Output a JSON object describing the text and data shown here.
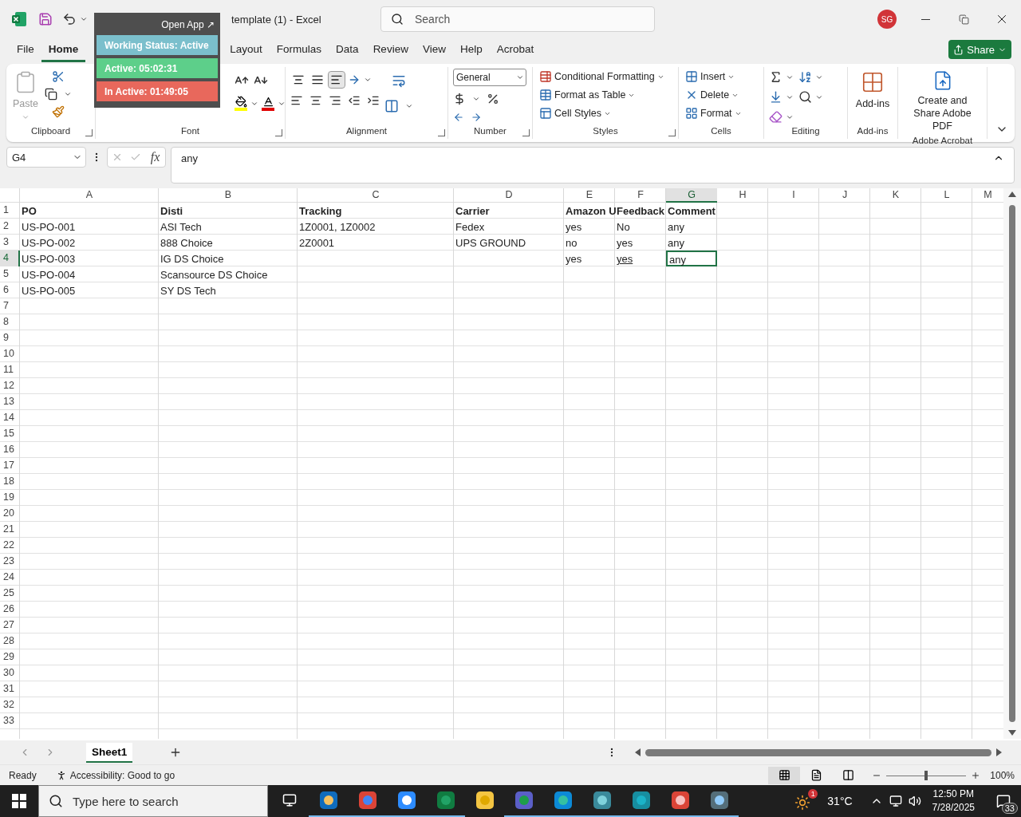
{
  "title_bar": {
    "title": "template (1)  -  Excel",
    "search": {
      "placeholder": "Search"
    },
    "avatar": "SG"
  },
  "tracker_widget": {
    "open_app": "Open App ↗",
    "statuses": [
      {
        "text": "Working Status: Active",
        "color": "#7bbfcc"
      },
      {
        "text": "Active: 05:02:31",
        "color": "#5dcf8a"
      },
      {
        "text": "In Active: 01:49:05",
        "color": "#e8685c"
      }
    ]
  },
  "tabs": [
    {
      "label": "File",
      "selected": false
    },
    {
      "label": "Home",
      "selected": true
    },
    {
      "label": "Layout",
      "selected": false
    },
    {
      "label": "Formulas",
      "selected": false
    },
    {
      "label": "Data",
      "selected": false
    },
    {
      "label": "Review",
      "selected": false
    },
    {
      "label": "View",
      "selected": false
    },
    {
      "label": "Help",
      "selected": false
    },
    {
      "label": "Acrobat",
      "selected": false
    }
  ],
  "share": "Share",
  "ribbon": {
    "clipboard": {
      "paste": "Paste",
      "label": "Clipboard"
    },
    "font": {
      "label": "Font"
    },
    "alignment": {
      "label": "Alignment",
      "vertical": [
        {
          "selected": false
        },
        {
          "selected": false
        },
        {
          "selected": true
        }
      ]
    },
    "number": {
      "format": "General",
      "label": "Number"
    },
    "styles": {
      "items": [
        "Conditional Formatting",
        "Format as Table",
        "Cell Styles"
      ],
      "label": "Styles"
    },
    "cells": {
      "items": [
        "Insert",
        "Delete",
        "Format"
      ],
      "label": "Cells"
    },
    "editing": {
      "label": "Editing"
    },
    "addins": {
      "button": "Add-ins",
      "label": "Add-ins"
    },
    "acrobat": {
      "button": "Create and Share Adobe PDF",
      "label": "Adobe Acrobat"
    }
  },
  "formula_bar": {
    "name_box": "G4",
    "fx": "fx",
    "value": "any"
  },
  "sheet": {
    "columns": [
      {
        "label": "A",
        "selected": false
      },
      {
        "label": "B",
        "selected": false
      },
      {
        "label": "C",
        "selected": false
      },
      {
        "label": "D",
        "selected": false
      },
      {
        "label": "E",
        "selected": false
      },
      {
        "label": "F",
        "selected": false
      },
      {
        "label": "G",
        "selected": true
      },
      {
        "label": "H",
        "selected": false
      },
      {
        "label": "I",
        "selected": false
      },
      {
        "label": "J",
        "selected": false
      },
      {
        "label": "K",
        "selected": false
      },
      {
        "label": "L",
        "selected": false
      },
      {
        "label": "M",
        "selected": false
      }
    ],
    "rows": [
      {
        "number": "1",
        "selected": false,
        "cells": [
          {
            "text": "PO",
            "bold": true,
            "underlined": false,
            "selected": false
          },
          {
            "text": "Disti",
            "bold": true,
            "underlined": false,
            "selected": false
          },
          {
            "text": "Tracking",
            "bold": true,
            "underlined": false,
            "selected": false
          },
          {
            "text": "Carrier",
            "bold": true,
            "underlined": false,
            "selected": false
          },
          {
            "text": "Amazon U",
            "bold": true,
            "underlined": false,
            "selected": false
          },
          {
            "text": "Feedback",
            "bold": true,
            "underlined": false,
            "selected": false
          },
          {
            "text": "Comment",
            "bold": true,
            "underlined": false,
            "selected": false
          }
        ]
      },
      {
        "number": "2",
        "selected": false,
        "cells": [
          {
            "text": "US-PO-001",
            "bold": false,
            "underlined": false,
            "selected": false
          },
          {
            "text": "ASI Tech",
            "bold": false,
            "underlined": false,
            "selected": false
          },
          {
            "text": "1Z0001, 1Z0002",
            "bold": false,
            "underlined": false,
            "selected": false
          },
          {
            "text": "Fedex",
            "bold": false,
            "underlined": false,
            "selected": false
          },
          {
            "text": "yes",
            "bold": false,
            "underlined": false,
            "selected": false
          },
          {
            "text": "No",
            "bold": false,
            "underlined": false,
            "selected": false
          },
          {
            "text": "any",
            "bold": false,
            "underlined": false,
            "selected": false
          }
        ]
      },
      {
        "number": "3",
        "selected": false,
        "cells": [
          {
            "text": "US-PO-002",
            "bold": false,
            "underlined": false,
            "selected": false
          },
          {
            "text": "888 Choice",
            "bold": false,
            "underlined": false,
            "selected": false
          },
          {
            "text": "2Z0001",
            "bold": false,
            "underlined": false,
            "selected": false
          },
          {
            "text": "UPS GROUND",
            "bold": false,
            "underlined": false,
            "selected": false
          },
          {
            "text": "no",
            "bold": false,
            "underlined": false,
            "selected": false
          },
          {
            "text": "yes",
            "bold": false,
            "underlined": false,
            "selected": false
          },
          {
            "text": "any",
            "bold": false,
            "underlined": false,
            "selected": false
          }
        ]
      },
      {
        "number": "4",
        "selected": true,
        "cells": [
          {
            "text": "US-PO-003",
            "bold": false,
            "underlined": false,
            "selected": false
          },
          {
            "text": "IG DS Choice",
            "bold": false,
            "underlined": false,
            "selected": false
          },
          null,
          null,
          {
            "text": "yes",
            "bold": false,
            "underlined": false,
            "selected": false
          },
          {
            "text": "yes",
            "bold": false,
            "underlined": true,
            "selected": false
          },
          {
            "text": "any",
            "bold": false,
            "underlined": false,
            "selected": true
          }
        ]
      },
      {
        "number": "5",
        "selected": false,
        "cells": [
          {
            "text": "US-PO-004",
            "bold": false,
            "underlined": false,
            "selected": false
          },
          {
            "text": "Scansource DS Choice",
            "bold": false,
            "underlined": false,
            "selected": false
          }
        ]
      },
      {
        "number": "6",
        "selected": false,
        "cells": [
          {
            "text": "US-PO-005",
            "bold": false,
            "underlined": false,
            "selected": false
          },
          {
            "text": "SY DS Tech",
            "bold": false,
            "underlined": false,
            "selected": false
          }
        ]
      },
      {
        "number": "7",
        "selected": false,
        "cells": []
      },
      {
        "number": "8",
        "selected": false,
        "cells": []
      },
      {
        "number": "9",
        "selected": false,
        "cells": []
      },
      {
        "number": "10",
        "selected": false,
        "cells": []
      },
      {
        "number": "11",
        "selected": false,
        "cells": []
      },
      {
        "number": "12",
        "selected": false,
        "cells": []
      },
      {
        "number": "13",
        "selected": false,
        "cells": []
      },
      {
        "number": "14",
        "selected": false,
        "cells": []
      },
      {
        "number": "15",
        "selected": false,
        "cells": []
      },
      {
        "number": "16",
        "selected": false,
        "cells": []
      },
      {
        "number": "17",
        "selected": false,
        "cells": []
      },
      {
        "number": "18",
        "selected": false,
        "cells": []
      },
      {
        "number": "19",
        "selected": false,
        "cells": []
      },
      {
        "number": "20",
        "selected": false,
        "cells": []
      },
      {
        "number": "21",
        "selected": false,
        "cells": []
      },
      {
        "number": "22",
        "selected": false,
        "cells": []
      },
      {
        "number": "23",
        "selected": false,
        "cells": []
      },
      {
        "number": "24",
        "selected": false,
        "cells": []
      },
      {
        "number": "25",
        "selected": false,
        "cells": []
      },
      {
        "number": "26",
        "selected": false,
        "cells": []
      },
      {
        "number": "27",
        "selected": false,
        "cells": []
      },
      {
        "number": "28",
        "selected": false,
        "cells": []
      },
      {
        "number": "29",
        "selected": false,
        "cells": []
      },
      {
        "number": "30",
        "selected": false,
        "cells": []
      },
      {
        "number": "31",
        "selected": false,
        "cells": []
      },
      {
        "number": "32",
        "selected": false,
        "cells": []
      },
      {
        "number": "33",
        "selected": false,
        "cells": []
      }
    ]
  },
  "sheet_tabs": [
    {
      "label": "Sheet1",
      "selected": true
    }
  ],
  "status_bar": {
    "ready": "Ready",
    "accessibility": "Accessibility: Good to go",
    "views": [
      {
        "selected": true
      },
      {
        "selected": false
      },
      {
        "selected": false
      }
    ],
    "zoom": {
      "level": 0.5
    },
    "zoom_text": "100%"
  },
  "taskbar": {
    "search": {
      "placeholder": "Type here to search"
    },
    "apps": [
      {
        "running": true
      },
      {
        "running": true
      },
      {
        "running": true
      },
      {
        "running": true
      },
      {
        "running": false
      },
      {
        "running": true
      },
      {
        "running": true
      },
      {
        "running": true
      },
      {
        "running": true
      },
      {
        "running": true
      },
      {
        "running": true
      }
    ],
    "weather_badge": "1",
    "temperature": "31°C",
    "time": "12:50 PM",
    "date": "7/28/2025",
    "notifications": "33"
  }
}
